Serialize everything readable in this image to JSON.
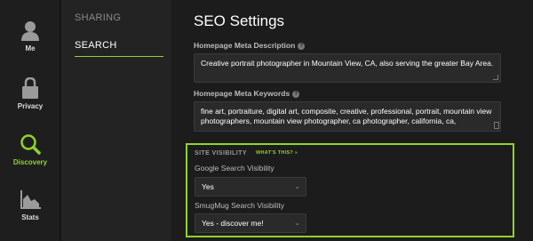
{
  "rail": {
    "items": [
      {
        "label": "Me",
        "icon": "person-icon"
      },
      {
        "label": "Privacy",
        "icon": "lock-icon"
      },
      {
        "label": "Discovery",
        "icon": "magnifier-icon",
        "active": true
      },
      {
        "label": "Stats",
        "icon": "stats-chart-icon"
      }
    ]
  },
  "subnav": {
    "items": [
      {
        "label": "SHARING"
      },
      {
        "label": "SEARCH",
        "active": true
      }
    ]
  },
  "main": {
    "title": "SEO Settings",
    "meta_description": {
      "label": "Homepage Meta Description",
      "value": "Creative portrait photographer in Mountain View, CA, also serving the greater Bay Area."
    },
    "meta_keywords": {
      "label": "Homepage Meta Keywords",
      "value": "fine art, portraiture, digital art, composite, creative, professional, portrait, mountain view photographers, mountain view photographer, ca photographer, california, ca,"
    },
    "visibility": {
      "heading": "SITE VISIBILITY",
      "whats_this": "WHAT'S THIS? »",
      "google": {
        "label": "Google Search Visibility",
        "value": "Yes"
      },
      "smugmug": {
        "label": "SmugMug Search Visibility",
        "value": "Yes - discover me!"
      }
    }
  },
  "colors": {
    "accent": "#8fd32a",
    "background": "#1c1c1c",
    "panel": "#232323"
  }
}
